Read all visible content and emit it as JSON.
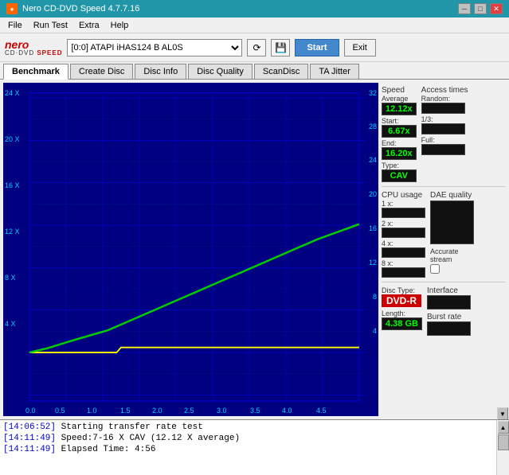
{
  "titleBar": {
    "title": "Nero CD-DVD Speed 4.7.7.16",
    "icon": "●",
    "minimizeLabel": "─",
    "maximizeLabel": "□",
    "closeLabel": "✕"
  },
  "menuBar": {
    "items": [
      "File",
      "Run Test",
      "Extra",
      "Help"
    ]
  },
  "toolbar": {
    "drive": "[0:0]  ATAPI iHAS124  B AL0S",
    "startLabel": "Start",
    "exitLabel": "Exit"
  },
  "tabs": [
    "Benchmark",
    "Create Disc",
    "Disc Info",
    "Disc Quality",
    "ScanDisc",
    "TA Jitter"
  ],
  "activeTab": "Benchmark",
  "chartAxes": {
    "yLeft": [
      "24 X",
      "20 X",
      "16 X",
      "12 X",
      "8 X",
      "4 X"
    ],
    "yRight": [
      "32",
      "28",
      "24",
      "20",
      "16",
      "12",
      "8",
      "4"
    ],
    "xAxis": [
      "0.0",
      "0.5",
      "1.0",
      "1.5",
      "2.0",
      "2.5",
      "3.0",
      "3.5",
      "4.0",
      "4.5"
    ]
  },
  "rightPanel": {
    "speedSection": {
      "label": "Speed",
      "average": {
        "label": "Average",
        "value": "12.12x"
      },
      "start": {
        "label": "Start:",
        "value": "6.67x"
      },
      "end": {
        "label": "End:",
        "value": "16.20x"
      },
      "type": {
        "label": "Type:",
        "value": "CAV"
      }
    },
    "accessTimes": {
      "label": "Access times",
      "random": {
        "label": "Random:",
        "value": ""
      },
      "onethird": {
        "label": "1/3:",
        "value": ""
      },
      "full": {
        "label": "Full:",
        "value": ""
      }
    },
    "cpuUsage": {
      "label": "CPU usage",
      "1x": {
        "label": "1 x:",
        "value": ""
      },
      "2x": {
        "label": "2 x:",
        "value": ""
      },
      "4x": {
        "label": "4 x:",
        "value": ""
      },
      "8x": {
        "label": "8 x:",
        "value": ""
      }
    },
    "daeQuality": {
      "label": "DAE quality",
      "value": ""
    },
    "accurateStream": {
      "label": "Accurate",
      "label2": "stream"
    },
    "discInfo": {
      "typeLabel": "Disc",
      "typeLabel2": "Type:",
      "typeValue": "DVD-R",
      "lengthLabel": "Length:",
      "lengthValue": "4.38 GB"
    },
    "interface": {
      "label": "Interface"
    },
    "burstRate": {
      "label": "Burst rate"
    }
  },
  "log": {
    "lines": [
      {
        "time": "[14:06:52]",
        "text": " Starting transfer rate test"
      },
      {
        "time": "[14:11:49]",
        "text": " Speed:7-16 X CAV (12.12 X average)"
      },
      {
        "time": "[14:11:49]",
        "text": " Elapsed Time: 4:56"
      }
    ]
  }
}
